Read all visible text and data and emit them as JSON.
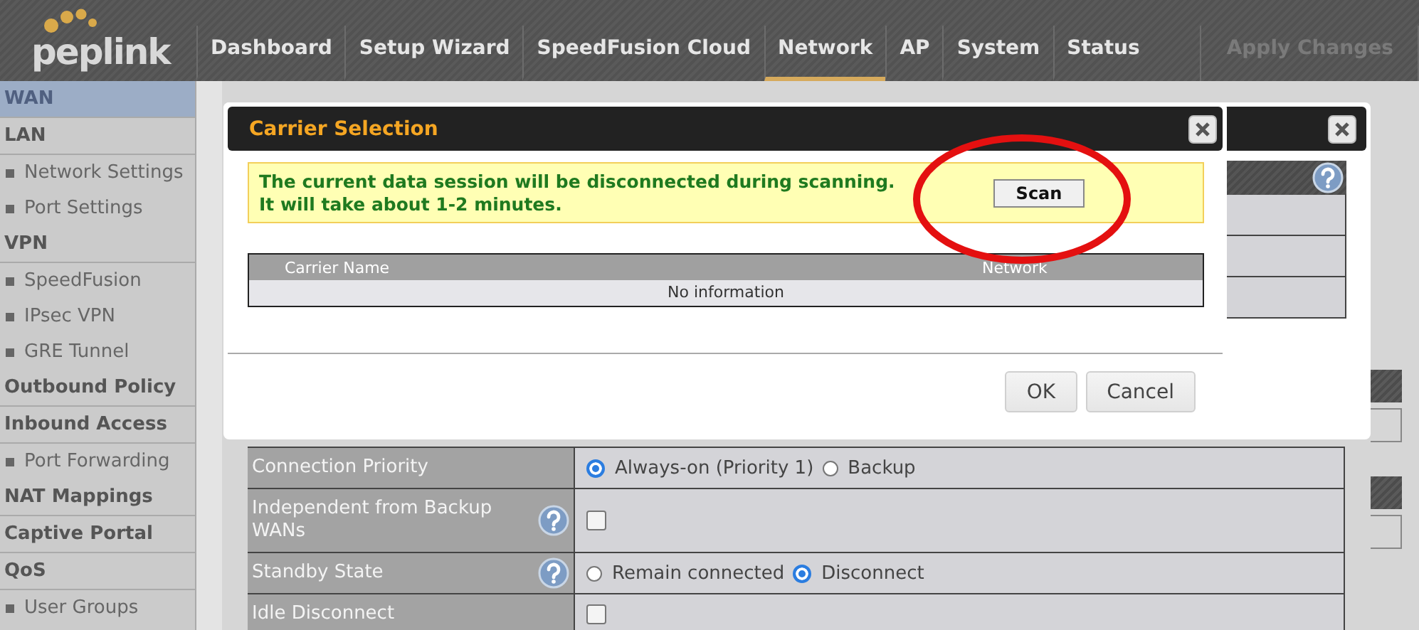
{
  "logo": "peplink",
  "nav": [
    {
      "label": "Dashboard",
      "selected": false
    },
    {
      "label": "Setup Wizard",
      "selected": false
    },
    {
      "label": "SpeedFusion Cloud",
      "selected": false
    },
    {
      "label": "Network",
      "selected": true
    },
    {
      "label": "AP",
      "selected": false
    },
    {
      "label": "System",
      "selected": false
    },
    {
      "label": "Status",
      "selected": false
    }
  ],
  "apply_changes": {
    "label": "Apply Changes",
    "disabled": true
  },
  "sidebar": [
    {
      "label": "WAN",
      "kind": "section",
      "selected": true
    },
    {
      "label": "LAN",
      "kind": "section",
      "selected": false
    },
    {
      "label": "Network Settings",
      "kind": "sub",
      "selected": false
    },
    {
      "label": "Port Settings",
      "kind": "sub",
      "selected": false
    },
    {
      "label": "VPN",
      "kind": "section",
      "selected": false
    },
    {
      "label": "SpeedFusion",
      "kind": "sub",
      "selected": false
    },
    {
      "label": "IPsec VPN",
      "kind": "sub",
      "selected": false
    },
    {
      "label": "GRE Tunnel",
      "kind": "sub",
      "selected": false
    },
    {
      "label": "Outbound Policy",
      "kind": "section",
      "selected": false
    },
    {
      "label": "Inbound Access",
      "kind": "section",
      "selected": false
    },
    {
      "label": "Port Forwarding",
      "kind": "sub",
      "selected": false
    },
    {
      "label": "NAT Mappings",
      "kind": "section",
      "selected": false
    },
    {
      "label": "Captive Portal",
      "kind": "section",
      "selected": false
    },
    {
      "label": "QoS",
      "kind": "section",
      "selected": false
    },
    {
      "label": "User Groups",
      "kind": "sub",
      "selected": false
    }
  ],
  "dialog": {
    "title": "Carrier Selection",
    "notice": [
      "The current data session will be disconnected during scanning.",
      "It will take about 1-2 minutes."
    ],
    "scan_button": "Scan",
    "columns": [
      "Carrier Name",
      "Network"
    ],
    "empty_text": "No information",
    "buttons": [
      "OK",
      "Cancel"
    ]
  },
  "form_rows": [
    {
      "label": "Connection Priority",
      "help": false,
      "kind": "radio",
      "options": [
        {
          "label": "Always-on (Priority 1)",
          "selected": true
        },
        {
          "label": "Backup",
          "selected": false
        }
      ]
    },
    {
      "label": "Independent from Backup WANs",
      "help": true,
      "kind": "checkbox",
      "checked": false
    },
    {
      "label": "Standby State",
      "help": true,
      "kind": "radio",
      "options": [
        {
          "label": "Remain connected",
          "selected": false
        },
        {
          "label": "Disconnect",
          "selected": true
        }
      ]
    },
    {
      "label": "Idle Disconnect",
      "help": false,
      "kind": "checkbox",
      "checked": false
    }
  ]
}
